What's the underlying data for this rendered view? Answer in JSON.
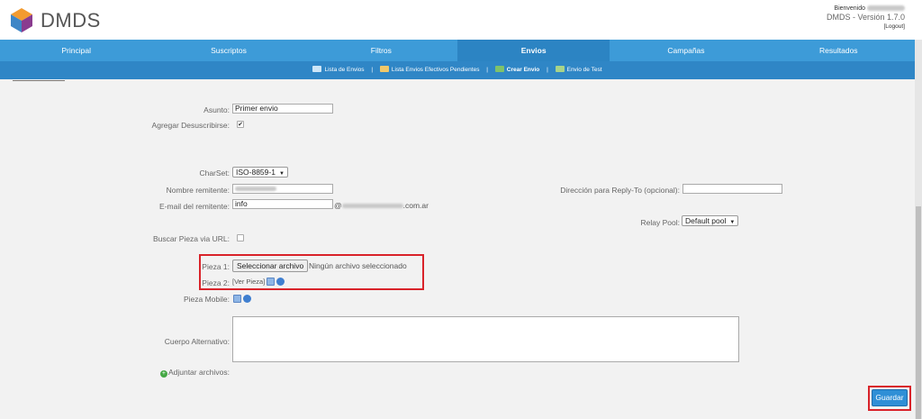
{
  "header": {
    "app_name": "DMDS",
    "welcome": "Bienvenido",
    "version": "DMDS - Versión 1.7.0",
    "logout": "[Logout]"
  },
  "nav": {
    "items": [
      {
        "label": "Principal"
      },
      {
        "label": "Suscriptos"
      },
      {
        "label": "Filtros"
      },
      {
        "label": "Envios",
        "active": true
      },
      {
        "label": "Campañas"
      },
      {
        "label": "Resultados"
      }
    ]
  },
  "subnav": {
    "items": [
      {
        "label": "Lista de Envios",
        "icon": "mail-icon"
      },
      {
        "label": "Lista Envios Efectivos Pendientes",
        "icon": "package-icon"
      },
      {
        "label": "Crear Envio",
        "icon": "send-icon",
        "active": true
      },
      {
        "label": "Envio de Test",
        "icon": "test-send-icon"
      }
    ]
  },
  "form": {
    "subject_label": "Asunto:",
    "subject_value": "Primer envio",
    "unsubscribe_label": "Agregar Desuscribirse:",
    "unsubscribe_checked": true,
    "charset_label": "CharSet:",
    "charset_value": "ISO-8859-1",
    "sender_name_label": "Nombre remitente:",
    "sender_email_label": "E-mail del remitente:",
    "sender_email_value": "info",
    "sender_email_at": "@",
    "sender_email_suffix": ".com.ar",
    "reply_to_label": "Dirección para Reply-To (opcional):",
    "relay_pool_label": "Relay Pool:",
    "relay_pool_value": "Default pool",
    "url_search_label": "Buscar Pieza via URL:",
    "url_search_checked": false,
    "piece1_label": "Pieza 1:",
    "file_button": "Seleccionar archivo",
    "file_status": "Ningún archivo seleccionado",
    "piece2_label": "Pieza 2:",
    "piece2_view": "[Ver Pieza]",
    "mobile_label": "Pieza Mobile:",
    "alt_body_label": "Cuerpo Alternativo:",
    "attach_label": "Adjuntar archivos:",
    "save_button": "Guardar"
  },
  "colors": {
    "nav": "#3d9bd8",
    "nav_active": "#2c84c3",
    "subnav": "#2f86c6",
    "highlight": "#d9232a",
    "save": "#2f8fd6"
  }
}
